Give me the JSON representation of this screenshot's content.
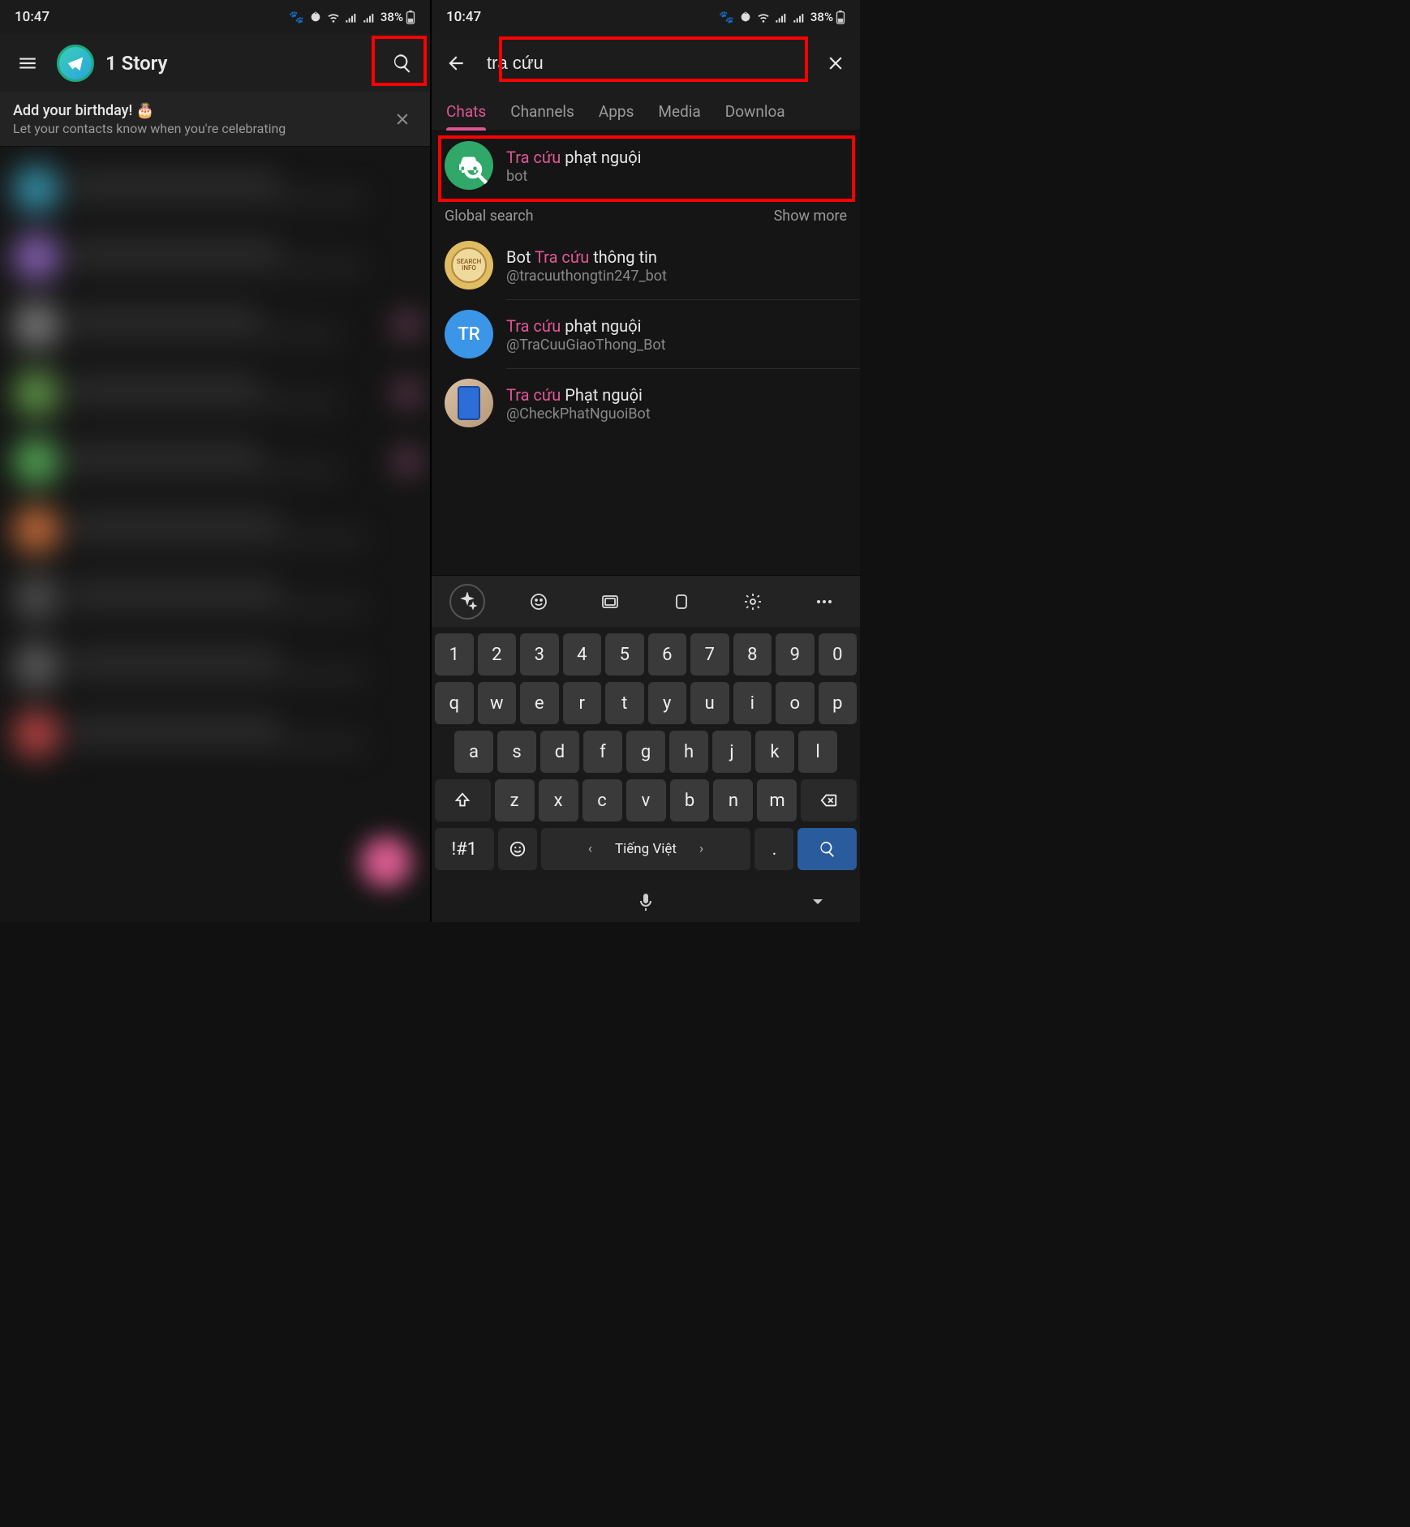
{
  "status": {
    "time": "10:47",
    "battery": "38%"
  },
  "left": {
    "title": "1 Story",
    "banner": {
      "title": "Add your birthday! 🎂",
      "sub": "Let your contacts know when you're celebrating"
    }
  },
  "right": {
    "search_value": "tra cứu",
    "tabs": [
      "Chats",
      "Channels",
      "Apps",
      "Media",
      "Downloa"
    ],
    "result0": {
      "title_hl": "Tra cứu",
      "title_rest": " phạt nguội",
      "sub": "bot"
    },
    "global_label": "Global search",
    "show_more": "Show more",
    "g1": {
      "pre": "Bot ",
      "hl": "Tra cứu",
      "rest": " thông tin",
      "sub": "@tracuuthongtin247_bot"
    },
    "g2": {
      "hl": "Tra cứu",
      "rest": " phạt nguội",
      "sub": "@TraCuuGiaoThong_Bot",
      "initials": "TR"
    },
    "g3": {
      "hl": "Tra cứu",
      "rest": " Phạt nguội",
      "sub": "@CheckPhatNguoiBot"
    }
  },
  "keyboard": {
    "row1": [
      "1",
      "2",
      "3",
      "4",
      "5",
      "6",
      "7",
      "8",
      "9",
      "0"
    ],
    "row2": [
      "q",
      "w",
      "e",
      "r",
      "t",
      "y",
      "u",
      "i",
      "o",
      "p"
    ],
    "row3": [
      "a",
      "s",
      "d",
      "f",
      "g",
      "h",
      "j",
      "k",
      "l"
    ],
    "row4": [
      "z",
      "x",
      "c",
      "v",
      "b",
      "n",
      "m"
    ],
    "sym": "!#1",
    "lang": "Tiếng Việt",
    "period": "."
  },
  "blur_chats": [
    {
      "av": "#3aa7c4",
      "dot": ""
    },
    {
      "av": "#9b6fd0",
      "dot": ""
    },
    {
      "av": "#8a8a8a",
      "dot": "#d86fa6"
    },
    {
      "av": "#6aa84f",
      "dot": "#d86fa6"
    },
    {
      "av": "#5fbf60",
      "dot": "#d86fa6"
    },
    {
      "av": "#e07a3f",
      "dot": ""
    },
    {
      "av": "#555",
      "dot": ""
    },
    {
      "av": "#666",
      "dot": ""
    },
    {
      "av": "#d04a4a",
      "dot": ""
    }
  ]
}
